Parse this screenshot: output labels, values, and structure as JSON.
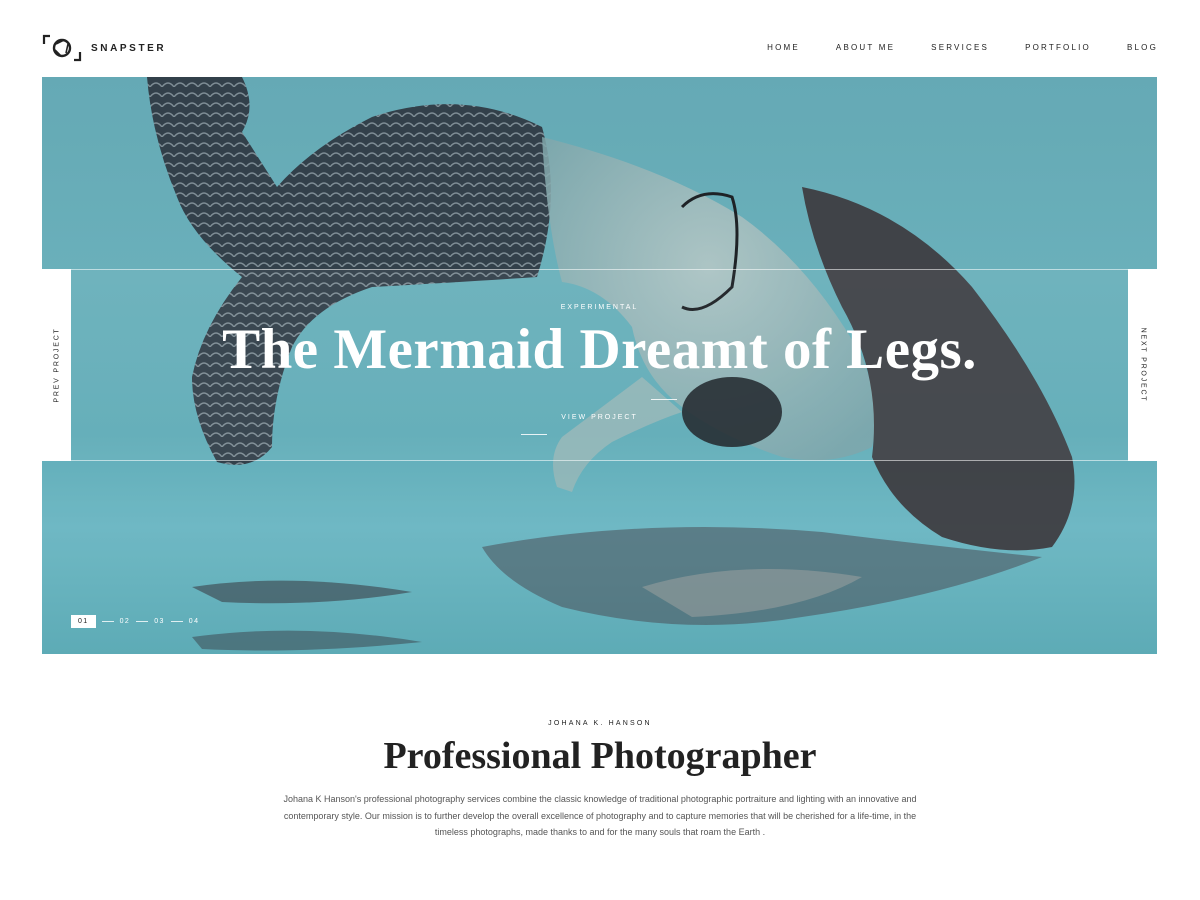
{
  "brand": {
    "name": "SNAPSTER",
    "logo_icon": "camera-shutter-icon"
  },
  "nav": {
    "items": [
      "HOME",
      "ABOUT ME",
      "SERVICES",
      "PORTFOLIO",
      "BLOG"
    ]
  },
  "hero": {
    "category": "EXPERIMENTAL",
    "title": "The Mermaid Dreamt of Legs.",
    "cta": "VIEW PROJECT",
    "prev": "PREV PROJECT",
    "next": "NEXT PROJECT",
    "pagination": [
      "01",
      "02",
      "03",
      "04"
    ],
    "active_page": "01",
    "image": "mermaid-underwater-photo"
  },
  "about": {
    "eyebrow": "JOHANA K. HANSON",
    "title": "Professional Photographer",
    "text": "Johana K Hanson's professional photography services combine the classic knowledge of traditional photographic portraiture and lighting with an innovative and contemporary style. Our mission is to further develop the overall excellence of photography and to capture memories that will be cherished for a life-time, in the timeless photographs, made thanks to and for the many souls that roam the Earth ."
  },
  "colors": {
    "water": "#5fa6b2",
    "text": "#222222",
    "muted": "#555555"
  }
}
